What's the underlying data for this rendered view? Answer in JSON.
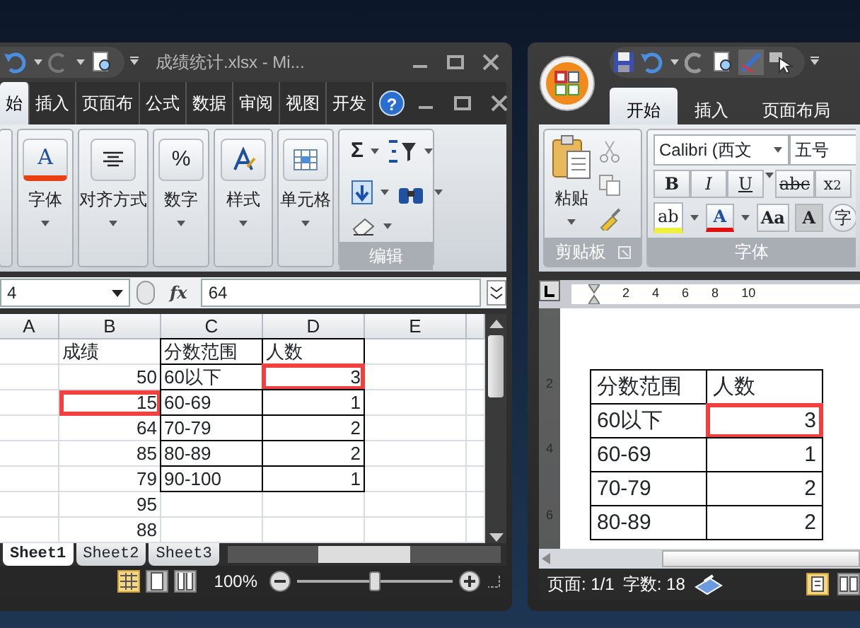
{
  "excel": {
    "title": "成绩统计.xlsx - Mi...",
    "tabs": [
      {
        "label": "始",
        "selected": true
      },
      {
        "label": "插入",
        "selected": false
      },
      {
        "label": "页面布",
        "selected": false
      },
      {
        "label": "公式",
        "selected": false
      },
      {
        "label": "数据",
        "selected": false
      },
      {
        "label": "审阅",
        "selected": false
      },
      {
        "label": "视图",
        "selected": false
      },
      {
        "label": "开发",
        "selected": false
      }
    ],
    "help_glyph": "?",
    "ribbon_groups": [
      {
        "kind": "font",
        "glyph": "A",
        "label": "字体"
      },
      {
        "kind": "align",
        "label": "对齐方式"
      },
      {
        "kind": "number",
        "glyph": "%",
        "label": "数字"
      },
      {
        "kind": "style",
        "label": "样式"
      },
      {
        "kind": "cells",
        "label": "单元格"
      }
    ],
    "editing": {
      "sum_glyph": "Σ",
      "label": "编辑"
    },
    "name_box": "4",
    "fx_label": "fx",
    "formula": "64",
    "columns": [
      "A",
      "B",
      "C",
      "D",
      "E"
    ],
    "rows": [
      {
        "kind": "header",
        "score": "成绩",
        "range": "分数范围",
        "count": "人数"
      },
      {
        "kind": "data",
        "score": "50",
        "range": "60以下",
        "count": "3",
        "count_marked": true
      },
      {
        "kind": "data",
        "score": "15",
        "range": "60-69",
        "count": "1",
        "score_marked": true
      },
      {
        "kind": "data",
        "score": "64",
        "range": "70-79",
        "count": "2"
      },
      {
        "kind": "data",
        "score": "85",
        "range": "80-89",
        "count": "2"
      },
      {
        "kind": "data",
        "score": "79",
        "range": "90-100",
        "count": "1"
      },
      {
        "kind": "data",
        "score": "95"
      },
      {
        "kind": "data",
        "score": "88"
      }
    ],
    "sheets": [
      {
        "label": "Sheet1",
        "selected": true
      },
      {
        "label": "Sheet2",
        "selected": false
      },
      {
        "label": "Sheet3",
        "selected": false
      }
    ],
    "view_buttons": [
      {
        "kind": "normal",
        "selected": true
      },
      {
        "kind": "layout",
        "selected": false
      },
      {
        "kind": "break",
        "selected": false
      }
    ],
    "zoom": {
      "reading": "100%",
      "level": 0.5
    }
  },
  "word": {
    "tabs": [
      {
        "label": "开始",
        "selected": true
      },
      {
        "label": "插入",
        "selected": false
      },
      {
        "label": "页面布局",
        "selected": false
      }
    ],
    "clipboard": {
      "paste": "粘贴",
      "label": "剪贴板"
    },
    "font": {
      "name": "Calibri (西文",
      "size": "五号",
      "label": "字体"
    },
    "format_buttons": [
      {
        "kind": "bold",
        "glyph": "B"
      },
      {
        "kind": "italic",
        "glyph": "I"
      },
      {
        "kind": "underline",
        "glyph": "U"
      },
      {
        "kind": "strike",
        "glyph": "abc"
      },
      {
        "kind": "sub",
        "glyph": "x$_{2}$"
      }
    ],
    "style_buttons": [
      {
        "kind": "highlight",
        "glyph": "ab"
      },
      {
        "kind": "color",
        "glyph": "A"
      },
      {
        "kind": "case",
        "glyph": "Aa"
      },
      {
        "kind": "shade",
        "glyph": "A"
      },
      {
        "kind": "circle",
        "glyph": "字"
      }
    ],
    "ruler_numbers": [
      "2",
      "4",
      "6",
      "8",
      "10"
    ],
    "vruler_numbers": [
      "2",
      "4",
      "6"
    ],
    "table": [
      {
        "kind": "header",
        "range": "分数范围",
        "count": "人数"
      },
      {
        "kind": "data",
        "range": "60以下",
        "count": "3",
        "count_marked": true
      },
      {
        "kind": "data",
        "range": "60-69",
        "count": "1"
      },
      {
        "kind": "data",
        "range": "70-79",
        "count": "2"
      },
      {
        "kind": "data",
        "range": "80-89",
        "count": "2"
      }
    ],
    "status": {
      "page": "页面: 1/1",
      "words": "字数: 18"
    },
    "view_buttons": [
      {
        "kind": "print",
        "selected": true
      },
      {
        "kind": "reading",
        "selected": false
      }
    ]
  }
}
